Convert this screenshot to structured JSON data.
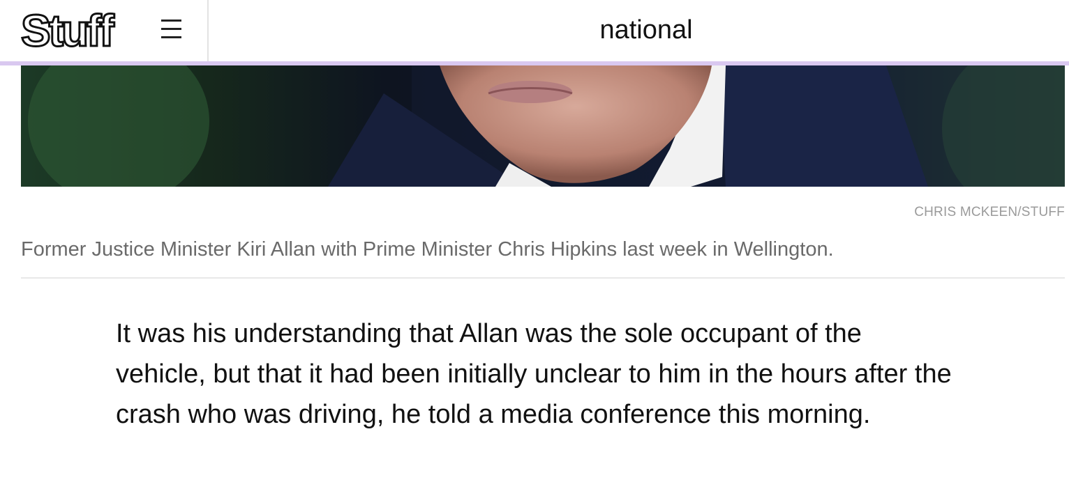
{
  "header": {
    "logo_text": "Stuff",
    "section": "national"
  },
  "image": {
    "credit": "CHRIS MCKEEN/STUFF",
    "caption": "Former Justice Minister Kiri Allan with Prime Minister Chris Hipkins last week in Wellington."
  },
  "article": {
    "paragraph": "It was his understanding that Allan was the sole occupant of the vehicle, but that it had been initially unclear to him in the hours after the crash who was driving, he told a media conference this morning."
  },
  "colors": {
    "accent_strip": "#d9c8f0",
    "caption_text": "#6a6a6a",
    "credit_text": "#9a9a9a"
  },
  "icons": [
    "menu-icon"
  ]
}
